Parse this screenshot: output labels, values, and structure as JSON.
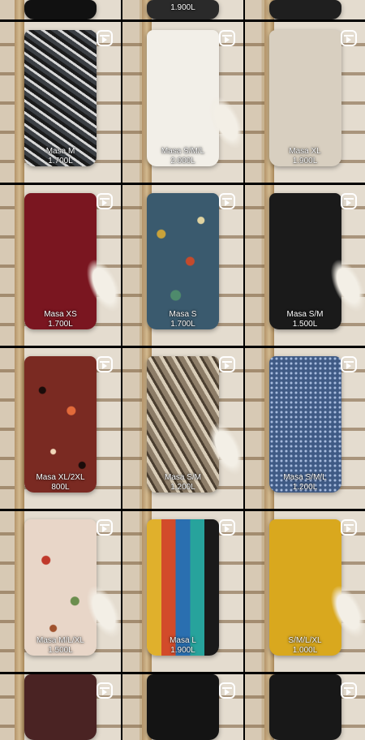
{
  "grid": {
    "icons": {
      "reel": "reel-icon"
    },
    "tiles": [
      {
        "size": "",
        "price": "",
        "garment_color": "#111111",
        "pattern": "dark"
      },
      {
        "size": "",
        "price": "1.900L",
        "garment_color": "#2a2a2a",
        "pattern": "dark"
      },
      {
        "size": "",
        "price": "",
        "garment_color": "#1f1f1f",
        "pattern": "dark"
      },
      {
        "size": "Masa M",
        "price": "1.700L",
        "garment_color": "#3b3f44",
        "pattern": "zebra"
      },
      {
        "size": "Masa S/M/L",
        "price": "2.000L",
        "garment_color": "#f2efe8",
        "pattern": "solid"
      },
      {
        "size": "Masa XL",
        "price": "1.900L",
        "garment_color": "#d8cfc0",
        "pattern": "solid"
      },
      {
        "size": "Masa XS",
        "price": "1.700L",
        "garment_color": "#7a1620",
        "pattern": "solid"
      },
      {
        "size": "Masa S",
        "price": "1.700L",
        "garment_color": "#3a5a6e",
        "pattern": "floral"
      },
      {
        "size": "Masa S/M",
        "price": "1.500L",
        "garment_color": "#1a1a1a",
        "pattern": "solid"
      },
      {
        "size": "Masa XL/2XL",
        "price": "800L",
        "garment_color": "#7a2a22",
        "pattern": "leopard"
      },
      {
        "size": "Masa S/M",
        "price": "1.200L",
        "garment_color": "#8d7d68",
        "pattern": "snake"
      },
      {
        "size": "Masa S/M/L",
        "price": "1.200L",
        "garment_color": "#3f5a85",
        "pattern": "dots"
      },
      {
        "size": "Masa M/L/XL",
        "price": "1.500L",
        "garment_color": "#e8d6c8",
        "pattern": "floral-light"
      },
      {
        "size": "Masa L",
        "price": "1.900L",
        "garment_color": "#d96a2a",
        "pattern": "multicolor"
      },
      {
        "size": "S/M/L/XL",
        "price": "1.000L",
        "garment_color": "#d9a81e",
        "pattern": "solid"
      },
      {
        "size": "",
        "price": "",
        "garment_color": "#4a2323",
        "pattern": "solid"
      },
      {
        "size": "",
        "price": "",
        "garment_color": "#141414",
        "pattern": "solid"
      },
      {
        "size": "",
        "price": "",
        "garment_color": "#181818",
        "pattern": "solid"
      }
    ]
  }
}
